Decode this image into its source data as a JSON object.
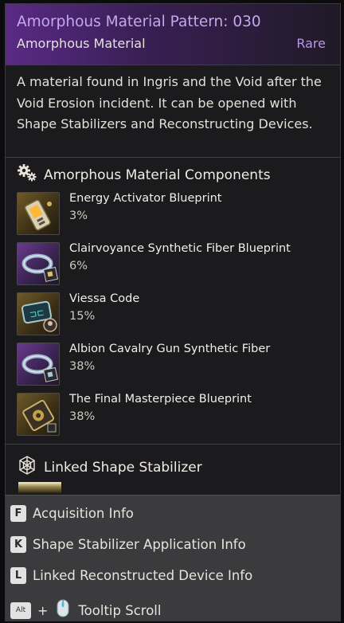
{
  "tooltip": {
    "title": "Amorphous Material Pattern: 030",
    "subtitle": "Amorphous Material",
    "rarity": "Rare",
    "description": "A material found in Ingris and the Void after the Void Erosion incident. It can be opened with Shape Stabilizers and Reconstructing Devices."
  },
  "components": {
    "heading": "Amorphous Material Components",
    "icon": "gears-icon",
    "items": [
      {
        "name": "Energy Activator Blueprint",
        "chance": "3%",
        "tier": "gold",
        "icon": "energy-activator-icon"
      },
      {
        "name": "Clairvoyance Synthetic Fiber Blueprint",
        "chance": "6%",
        "tier": "purple",
        "icon": "synthetic-fiber-ring-icon"
      },
      {
        "name": "Viessa Code",
        "chance": "15%",
        "tier": "gold",
        "icon": "code-card-icon"
      },
      {
        "name": "Albion Cavalry Gun Synthetic Fiber",
        "chance": "38%",
        "tier": "purple",
        "icon": "synthetic-fiber-ring-icon"
      },
      {
        "name": "The Final Masterpiece Blueprint",
        "chance": "38%",
        "tier": "gold",
        "icon": "blueprint-device-icon"
      }
    ]
  },
  "linked": {
    "heading": "Linked Shape Stabilizer",
    "icon": "web-icon"
  },
  "hints": {
    "acquisition": {
      "key": "F",
      "label": "Acquisition Info"
    },
    "stabilizer": {
      "key": "K",
      "label": "Shape Stabilizer Application Info"
    },
    "device": {
      "key": "L",
      "label": "Linked Reconstructed Device Info"
    },
    "scroll": {
      "key": "Alt",
      "plus": "+",
      "label": "Tooltip Scroll",
      "icon": "mouse-icon"
    }
  },
  "colors": {
    "title": "#c4a8ee",
    "rarity": "#b896ea",
    "header_gradient_start": "#5a2a86",
    "panel": "#1b1b1d",
    "footer": "#3b3b3e"
  }
}
